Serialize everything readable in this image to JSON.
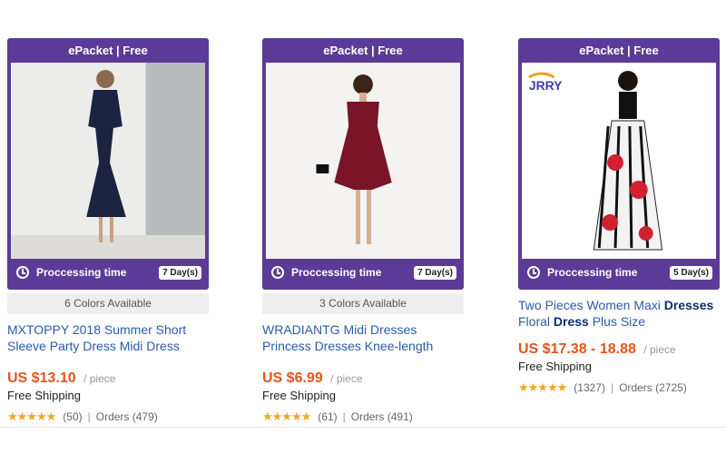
{
  "products": [
    {
      "shipping_badge": "ePacket | Free",
      "processing_label": "Proccessing time",
      "processing_days": "7 Day(s)",
      "colors_available": "6 Colors Available",
      "title_line1": "MXTOPPY 2018 Summer Short",
      "title_line2": "Sleeve Party Dress Midi Dress",
      "price": "US $13.10",
      "per_unit": "/ piece",
      "shipping": "Free Shipping",
      "stars": "★★★★★",
      "rating_count": "(50)",
      "orders": "Orders (479)",
      "image": "navy-midi-dress-photo"
    },
    {
      "shipping_badge": "ePacket | Free",
      "processing_label": "Proccessing time",
      "processing_days": "7 Day(s)",
      "colors_available": "3 Colors Available",
      "title_line1": "WRADIANTG Midi Dresses",
      "title_line2": "Princess Dresses Knee-length",
      "price": "US $6.99",
      "per_unit": "/ piece",
      "shipping": "Free Shipping",
      "stars": "★★★★★",
      "rating_count": "(61)",
      "orders": "Orders (491)",
      "image": "burgundy-dress-photo"
    },
    {
      "shipping_badge": "ePacket | Free",
      "processing_label": "Proccessing time",
      "processing_days": "5 Day(s)",
      "brand_logo": "JRRY",
      "title_a": "Two Pieces Women Maxi ",
      "title_b": "Dresses",
      "title_c": "Floral ",
      "title_d": "Dress",
      "title_e": " Plus Size",
      "price": "US $17.38 - 18.88",
      "per_unit": "/ piece",
      "shipping": "Free Shipping",
      "stars": "★★★★★",
      "rating_count": "(1327)",
      "orders": "Orders (2725)",
      "image": "floral-maxi-skirt-photo"
    }
  ],
  "separator": "|",
  "colors": {
    "frame": "#5b3b98",
    "price": "#e5541d",
    "title": "#2b5aa8",
    "star": "#f3a61e"
  }
}
